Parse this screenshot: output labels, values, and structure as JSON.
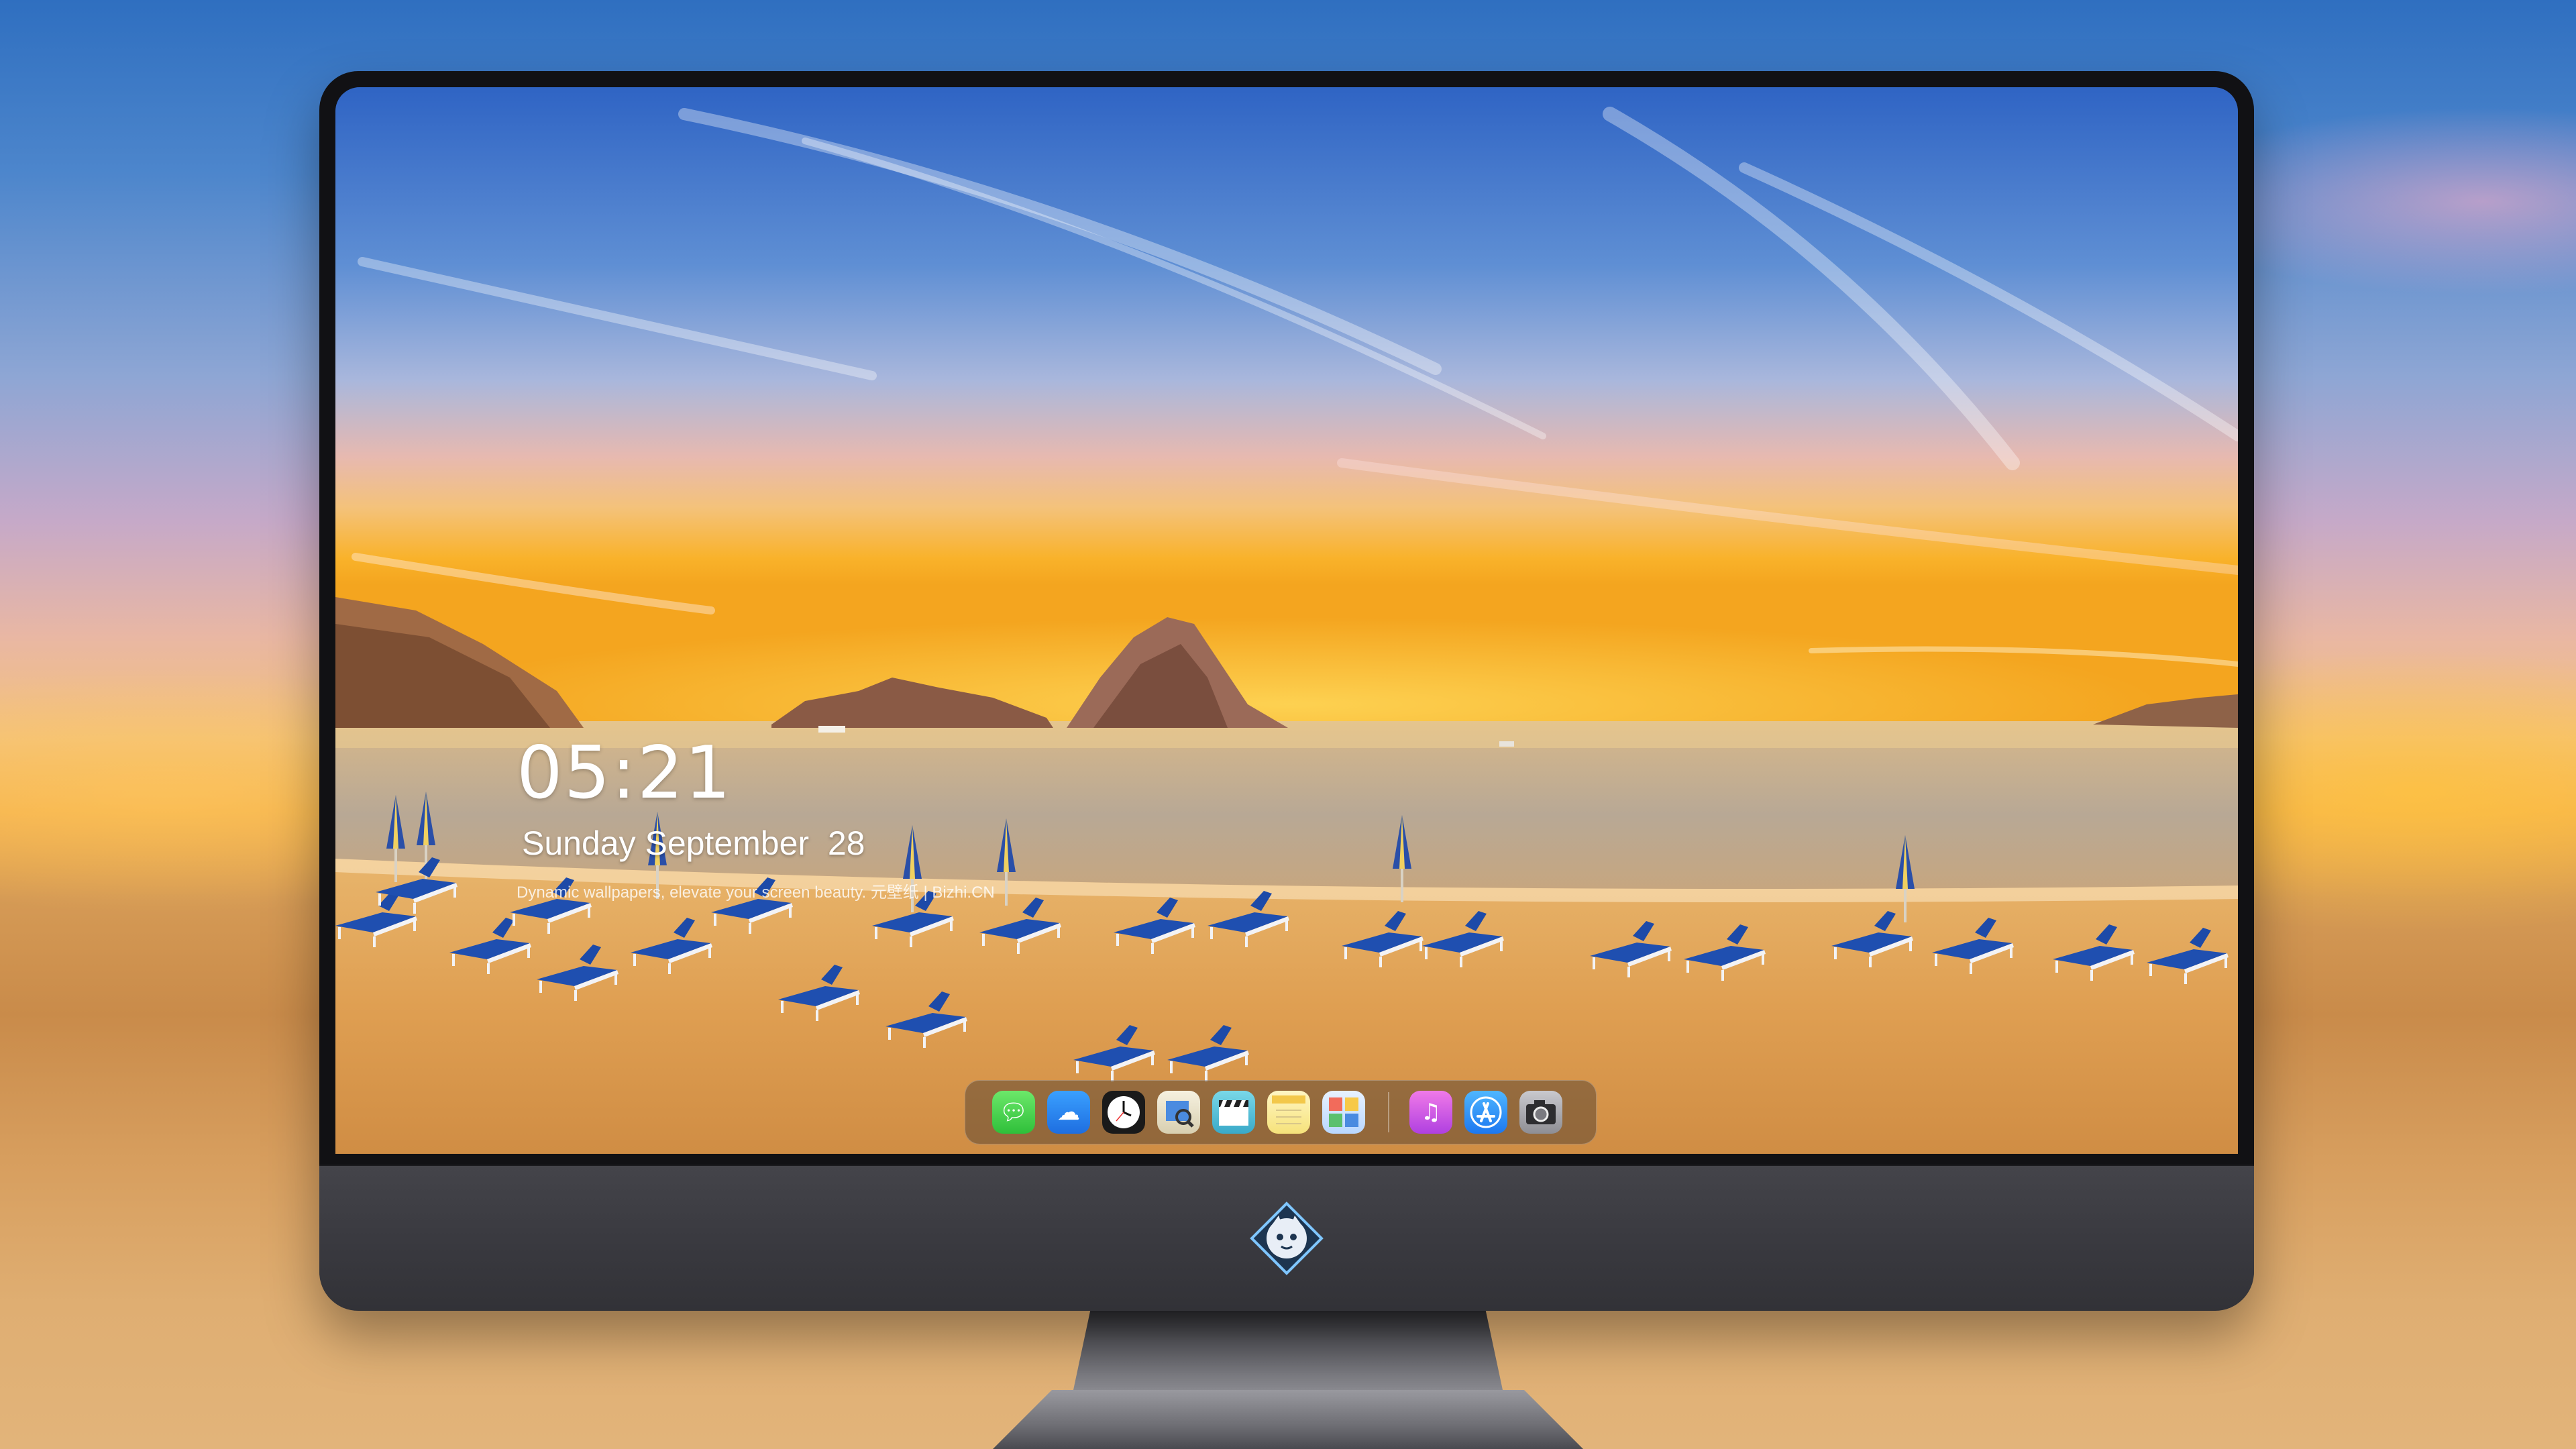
{
  "lockscreen": {
    "time": "05:21",
    "date": "Sunday September  28",
    "tagline": "Dynamic wallpapers, elevate your screen beauty. 元壁纸 | Bizhi.CN"
  },
  "dock": {
    "items": [
      {
        "name": "Messages",
        "icon": "messages-icon",
        "glyph": "☁"
      },
      {
        "name": "Weather",
        "icon": "weather-icon",
        "glyph": "☁"
      },
      {
        "name": "Clock",
        "icon": "clock-icon",
        "glyph": "◷"
      },
      {
        "name": "Preview",
        "icon": "preview-icon",
        "glyph": "▤"
      },
      {
        "name": "Clips",
        "icon": "movie-icon",
        "glyph": "▶"
      },
      {
        "name": "Notes",
        "icon": "notes-icon",
        "glyph": "≡"
      },
      {
        "name": "Photo Booth",
        "icon": "photos-icon",
        "glyph": "▦"
      },
      {
        "name": "Music",
        "icon": "music-icon",
        "glyph": "♫"
      },
      {
        "name": "App Store",
        "icon": "app-store-icon",
        "glyph": "A"
      },
      {
        "name": "Camera",
        "icon": "camera-icon",
        "glyph": "◉"
      }
    ]
  },
  "colors": {
    "sky_top": "#2f64c4",
    "sunset": "#f7b12e",
    "sand": "#e0a65a",
    "chair_blue": "#1f4fb0",
    "bezel": "#111114",
    "chin": "#3a3a40"
  }
}
